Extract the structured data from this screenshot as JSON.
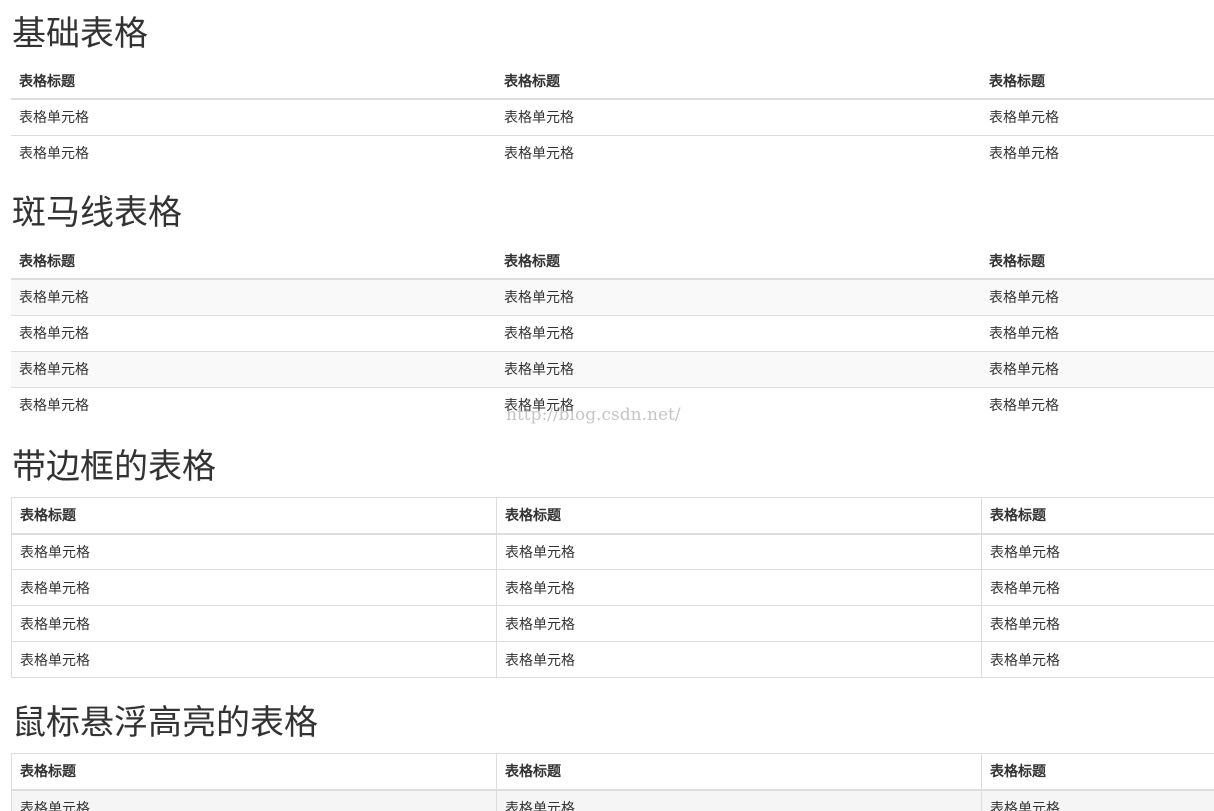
{
  "sections": [
    {
      "title": "基础表格",
      "headers": [
        "表格标题",
        "表格标题",
        "表格标题"
      ],
      "rows": [
        [
          "表格单元格",
          "表格单元格",
          "表格单元格"
        ],
        [
          "表格单元格",
          "表格单元格",
          "表格单元格"
        ]
      ]
    },
    {
      "title": "斑马线表格",
      "headers": [
        "表格标题",
        "表格标题",
        "表格标题"
      ],
      "rows": [
        [
          "表格单元格",
          "表格单元格",
          "表格单元格"
        ],
        [
          "表格单元格",
          "表格单元格",
          "表格单元格"
        ],
        [
          "表格单元格",
          "表格单元格",
          "表格单元格"
        ],
        [
          "表格单元格",
          "表格单元格",
          "表格单元格"
        ]
      ]
    },
    {
      "title": "带边框的表格",
      "headers": [
        "表格标题",
        "表格标题",
        "表格标题"
      ],
      "rows": [
        [
          "表格单元格",
          "表格单元格",
          "表格单元格"
        ],
        [
          "表格单元格",
          "表格单元格",
          "表格单元格"
        ],
        [
          "表格单元格",
          "表格单元格",
          "表格单元格"
        ],
        [
          "表格单元格",
          "表格单元格",
          "表格单元格"
        ]
      ]
    },
    {
      "title": "鼠标悬浮高亮的表格",
      "headers": [
        "表格标题",
        "表格标题",
        "表格标题"
      ],
      "rows": [
        [
          "表格单元格",
          "表格单元格",
          "表格单元格"
        ]
      ]
    }
  ],
  "watermark": "http://blog.csdn.net/",
  "colors": {
    "text": "#333333",
    "border": "#dddddd",
    "stripe": "#f9f9f9"
  }
}
